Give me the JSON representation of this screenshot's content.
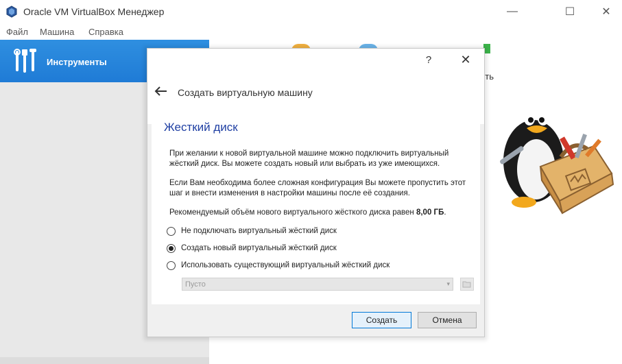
{
  "window": {
    "title": "Oracle VM VirtualBox Менеджер",
    "minimize_glyph": "—",
    "maximize_glyph": "☐",
    "close_glyph": "✕"
  },
  "menu": [
    "Файл",
    "Машина",
    "Справка"
  ],
  "left_panel": {
    "tools_label": "Инструменты"
  },
  "toolbar_peek_text": "ить",
  "dialog": {
    "help_glyph": "?",
    "close_glyph": "✕",
    "wizard_title": "Создать виртуальную машину",
    "heading": "Жесткий диск",
    "para1": "При желании к новой виртуальной машине можно подключить виртуальный жёсткий диск. Вы можете создать новый или выбрать из уже имеющихся.",
    "para2": "Если Вам необходима более сложная конфигурация Вы можете пропустить этот шаг и внести изменения в настройки машины после её создания.",
    "para3_prefix": "Рекомендуемый объём нового виртуального жёсткого диска равен ",
    "para3_value": "8,00 ГБ",
    "para3_suffix": ".",
    "options": [
      {
        "label": "Не подключать виртуальный жёсткий диск",
        "selected": false
      },
      {
        "label": "Создать новый виртуальный жёсткий диск",
        "selected": true
      },
      {
        "label": "Использовать существующий виртуальный жёсткий диск",
        "selected": false
      }
    ],
    "combo_value": "Пусто",
    "combo_arrow": "▾",
    "create_button": "Создать",
    "cancel_button": "Отмена"
  },
  "icons": {
    "app": "virtualbox-icon",
    "tools": "tools-icon",
    "back": "back-arrow-icon",
    "folder": "folder-icon",
    "mascot": "penguin-toolbox-illustration"
  },
  "colors": {
    "tools_bg": "#1f7bd6",
    "heading": "#1f3fa3",
    "primary_border": "#0078d7"
  }
}
